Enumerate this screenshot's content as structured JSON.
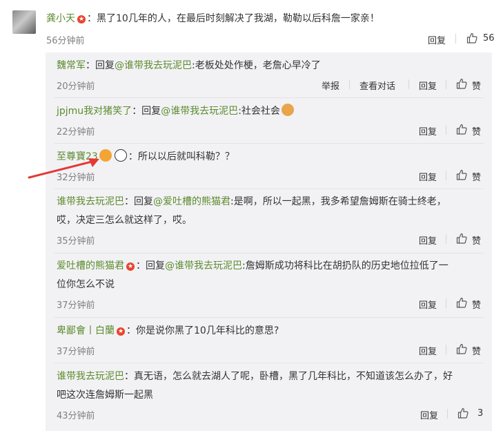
{
  "main_comment": {
    "username": "龚小天",
    "text": "：黑了10几年的人，在最后时刻解决了我湖，勒勒以后科詹一家亲！",
    "time": "56分钟前",
    "reply_label": "回复",
    "likes": "56"
  },
  "replies": [
    {
      "username": "魏常军",
      "prefix": "：回复",
      "mention": "@谁带我去玩泥巴",
      "text": ":老板处处作梗，老詹心早冷了",
      "time": "20分钟前",
      "report_label": "举报",
      "view_conv_label": "查看对话",
      "reply_label": "回复",
      "like_label": "赞"
    },
    {
      "username": "jpjmu我对猪笑了",
      "prefix": "：回复",
      "mention": "@谁带我去玩泥巴",
      "text": ":社会社会",
      "time": "22分钟前",
      "reply_label": "回复",
      "like_label": "赞"
    },
    {
      "username": "至尊寶23",
      "text": "：所以以后就叫科勒？？",
      "time": "32分钟前",
      "reply_label": "回复",
      "like_label": "赞"
    },
    {
      "username": "谁带我去玩泥巴",
      "prefix": "：回复",
      "mention": "@爱吐槽的熊猫君",
      "text": ":是啊，所以一起黑，我多希望詹姆斯在骑士终老，",
      "text2": "哎，决定三怎么就这样了，哎。",
      "time": "35分钟前",
      "reply_label": "回复",
      "like_label": "赞"
    },
    {
      "username": "爱吐槽的熊猫君",
      "prefix": "：回复",
      "mention": "@谁带我去玩泥巴",
      "text": ":詹姆斯成功将科比在胡扔队的历史地位拉低了一",
      "text2": "位你怎么不说",
      "time": "37分钟前",
      "reply_label": "回复",
      "like_label": "赞"
    },
    {
      "username": "卑鄙會丨白蘭",
      "text": "：你是说你黑了10几年科比的意思?",
      "time": "37分钟前",
      "reply_label": "回复",
      "like_label": "赞"
    },
    {
      "username": "谁带我去玩泥巴",
      "text": "：真无语，怎么就去湖人了呢，卧槽，黑了几年科比，不知道该怎么办了，好",
      "text2": "吧这次连詹姆斯一起黑",
      "time": "43分钟前",
      "reply_label": "回复",
      "likes": "3"
    }
  ],
  "colors": {
    "username": "#5c8b2d",
    "reply_bg": "#f2f2f5",
    "time": "#808080",
    "star": "#e8442e",
    "arrow": "#e53935"
  }
}
